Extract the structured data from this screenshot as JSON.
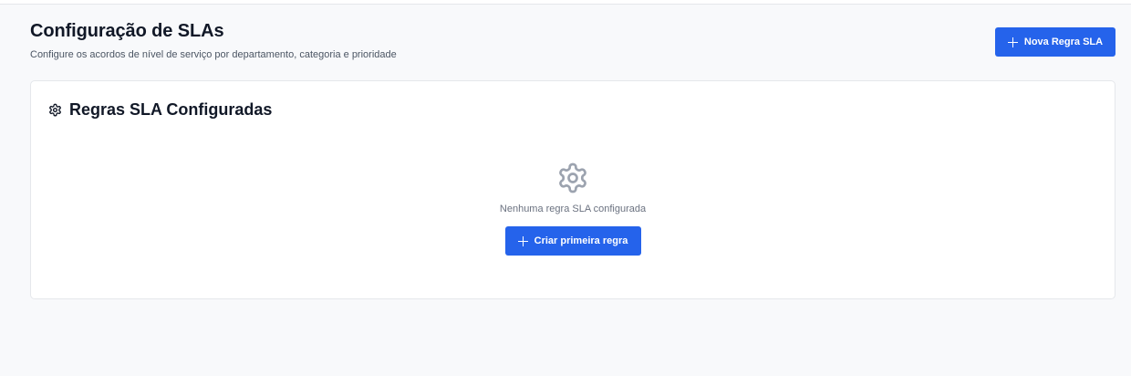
{
  "header": {
    "title": "Configuração de SLAs",
    "subtitle": "Configure os acordos de nível de serviço por departamento, categoria e prioridade",
    "new_rule_label": "Nova Regra SLA"
  },
  "card": {
    "title": "Regras SLA Configuradas",
    "icon": "gear-icon",
    "empty_icon": "gear-icon",
    "empty_text": "Nenhuma regra SLA configurada",
    "create_first_label": "Criar primeira regra"
  },
  "colors": {
    "primary": "#2563eb",
    "background": "#f8f9fb",
    "card": "#ffffff",
    "border": "#e5e7eb",
    "muted_icon": "#9ca3af"
  }
}
